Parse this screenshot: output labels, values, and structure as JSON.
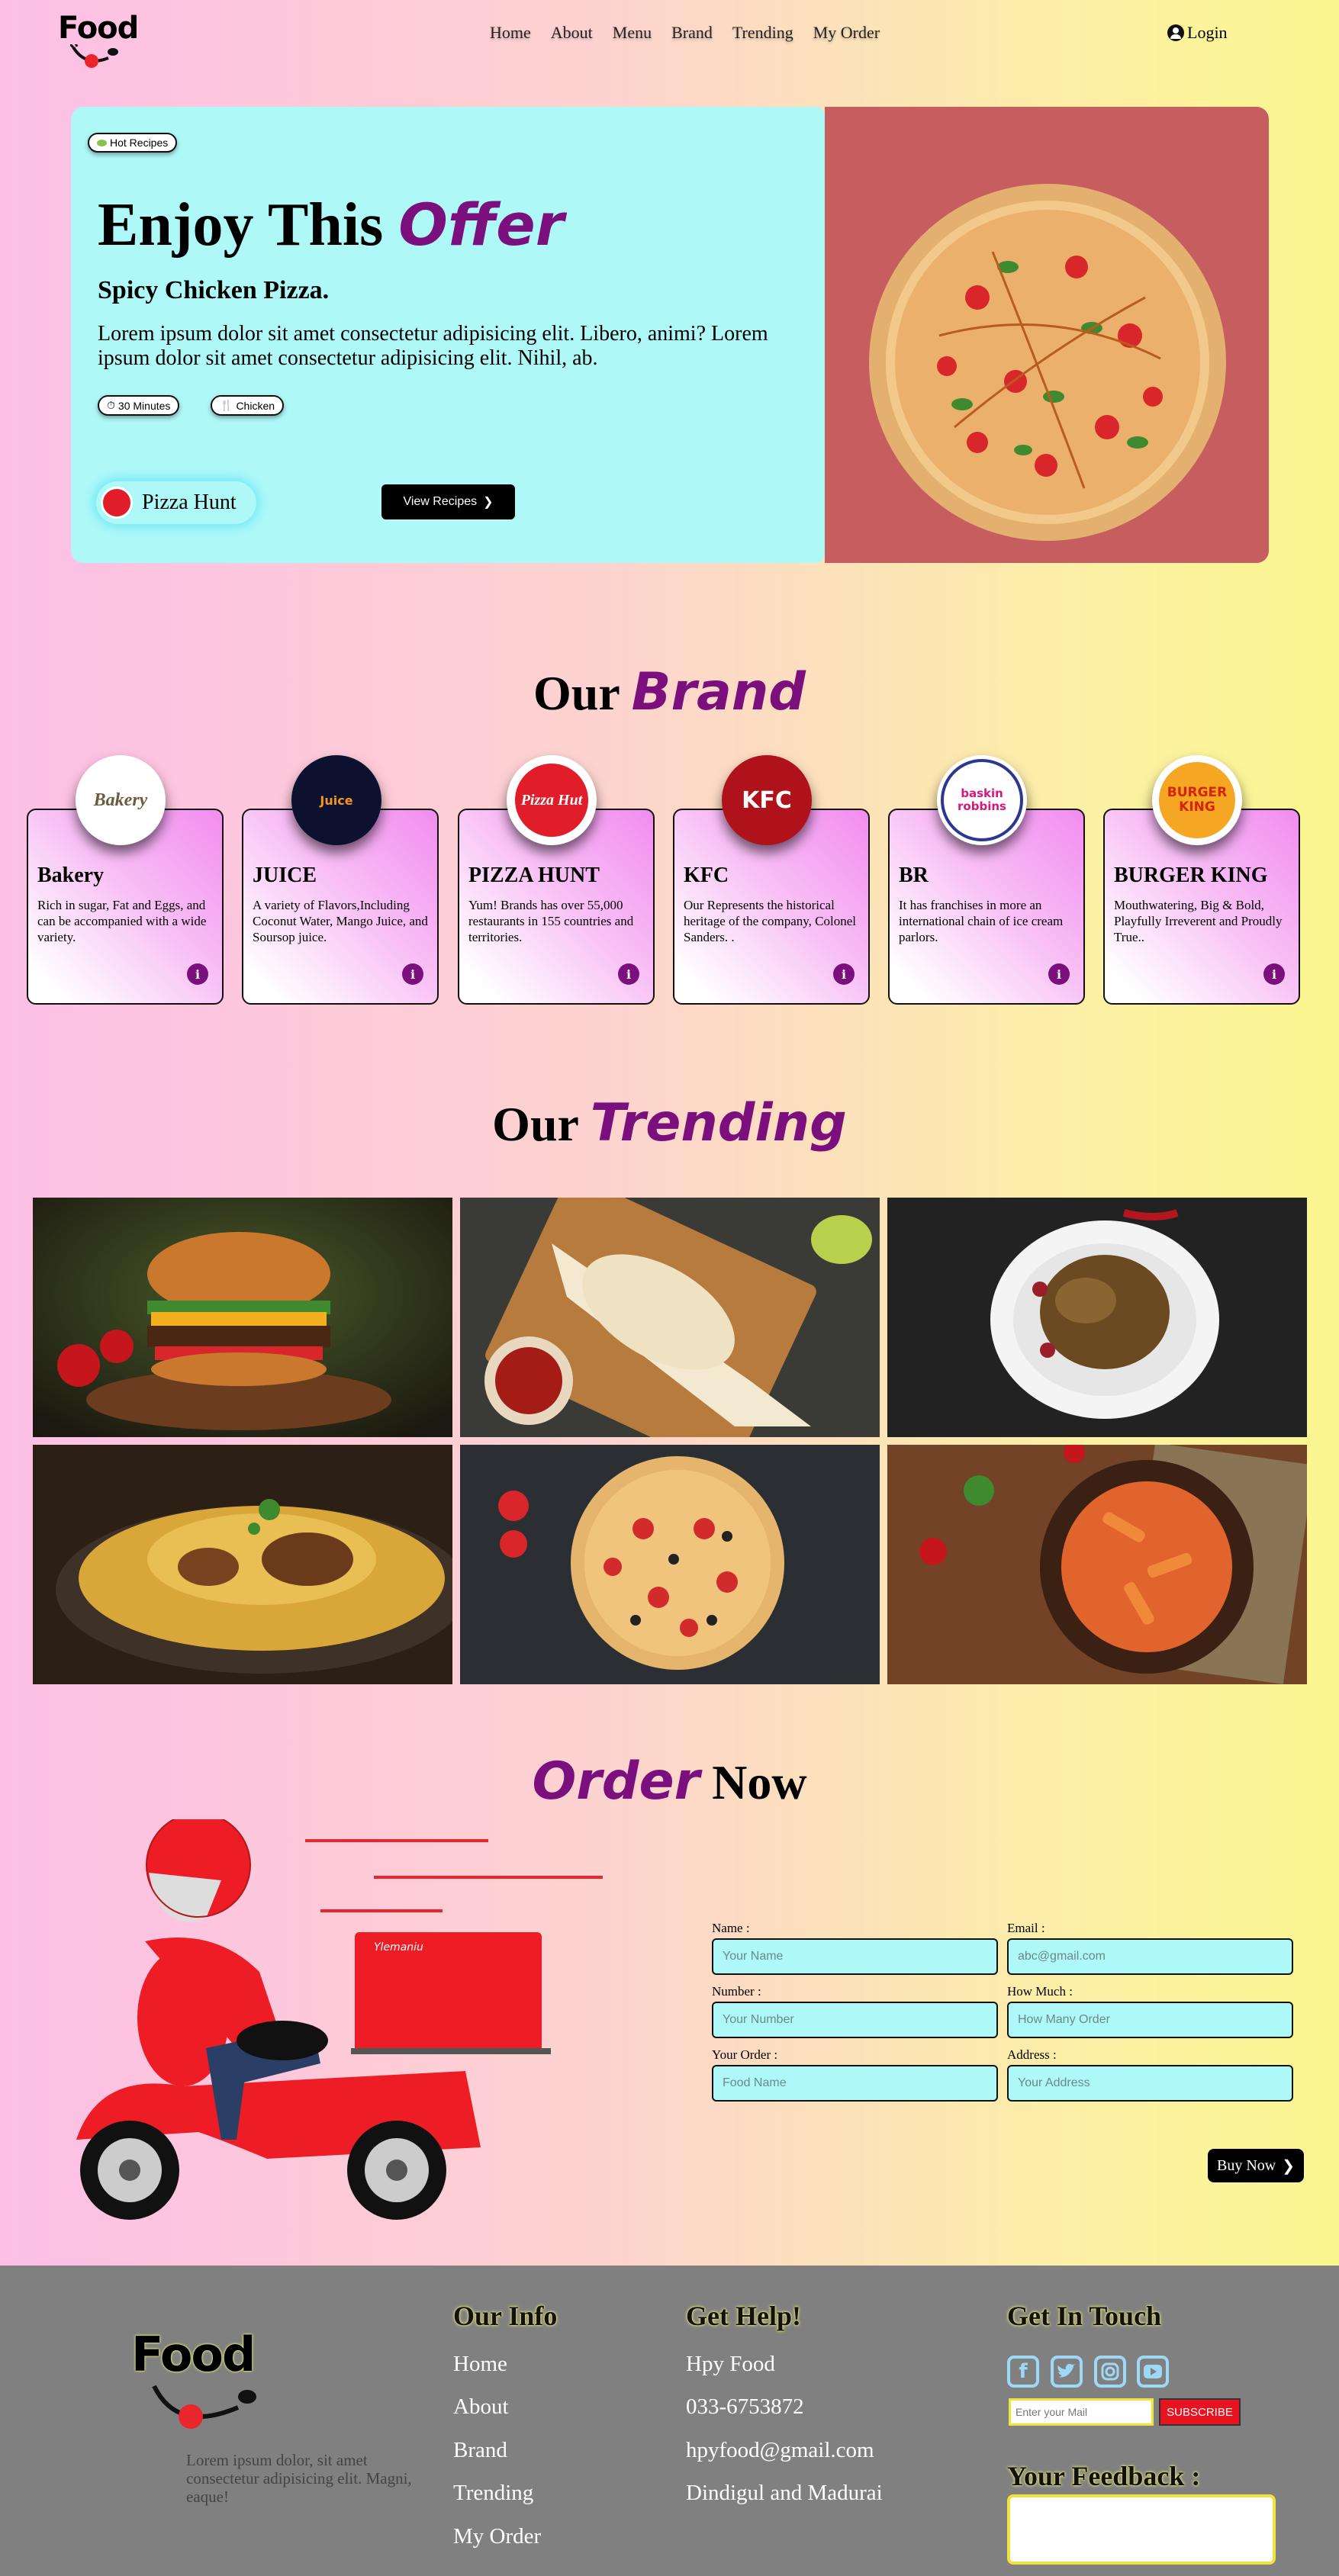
{
  "nav": {
    "logo": "Food",
    "menu": [
      "Home",
      "About",
      "Menu",
      "Brand",
      "Trending",
      "My Order"
    ],
    "login": "Login"
  },
  "hero": {
    "badge": "Hot Recipes",
    "title": "Enjoy This",
    "title_accent": "Offer",
    "subtitle": "Spicy Chicken Pizza.",
    "description": "Lorem ipsum dolor sit amet consectetur adipisicing elit. Libero, animi? Lorem ipsum dolor sit amet consectetur adipisicing elit. Nihil, ab.",
    "time_tag": "30 Minutes",
    "category_tag": "Chicken",
    "brand_name": "Pizza Hunt",
    "cta": "View Recipes"
  },
  "brands_section": {
    "title": "Our",
    "title_accent": "Brand",
    "items": [
      {
        "name": "Bakery",
        "desc": "Rich in sugar, Fat and Eggs, and can be accompanied with a wide variety.",
        "logo_text": "Bakery"
      },
      {
        "name": "JUICE",
        "desc": "A variety of Flavors,Including Coconut Water, Mango Juice, and Soursop juice.",
        "logo_text": "Juice"
      },
      {
        "name": "PIZZA HUNT",
        "desc": "Yum! Brands has over 55,000 restaurants in 155 countries and territories.",
        "logo_text": "Pizza Hut"
      },
      {
        "name": "KFC",
        "desc": "Our Represents the historical heritage of the company, Colonel Sanders. .",
        "logo_text": "KFC"
      },
      {
        "name": "BR",
        "desc": "It has franchises in more an international chain of ice cream parlors.",
        "logo_text": "baskin robbins"
      },
      {
        "name": "BURGER KING",
        "desc": "Mouthwatering, Big & Bold, Playfully Irreverent and Proudly True..",
        "logo_text": "BURGER KING"
      }
    ],
    "info_glyph": "i"
  },
  "trending_section": {
    "title": "Our",
    "title_accent": "Trending"
  },
  "order_section": {
    "title_accent": "Order",
    "title": "Now",
    "scooter_brand": "Ylemaniu",
    "fields": {
      "name_label": "Name :",
      "name_ph": "Your Name",
      "email_label": "Email :",
      "email_ph": "abc@gmail.com",
      "number_label": "Number :",
      "number_ph": "Your Number",
      "howmuch_label": "How Much :",
      "howmuch_ph": "How Many Order",
      "order_label": "Your Order :",
      "order_ph": "Food Name",
      "address_label": "Address :",
      "address_ph": "Your Address"
    },
    "buy": "Buy Now"
  },
  "footer": {
    "logo": "Food",
    "about": "Lorem ipsum dolor, sit amet consectetur adipisicing elit. Magni, eaque!",
    "info_title": "Our Info",
    "info_links": [
      "Home",
      "About",
      "Brand",
      "Trending",
      "My Order"
    ],
    "help_title": "Get Help!",
    "help_items": [
      "Hpy Food",
      "033-6753872",
      "hpyfood@gmail.com",
      "Dindigul and Madurai"
    ],
    "touch_title": "Get In Touch",
    "social_icons": [
      "facebook-icon",
      "twitter-icon",
      "instagram-icon",
      "youtube-icon"
    ],
    "mail_ph": "Enter your Mail",
    "subscribe": "SUBSCRIBE",
    "feedback_title": "Your Feedback :"
  }
}
